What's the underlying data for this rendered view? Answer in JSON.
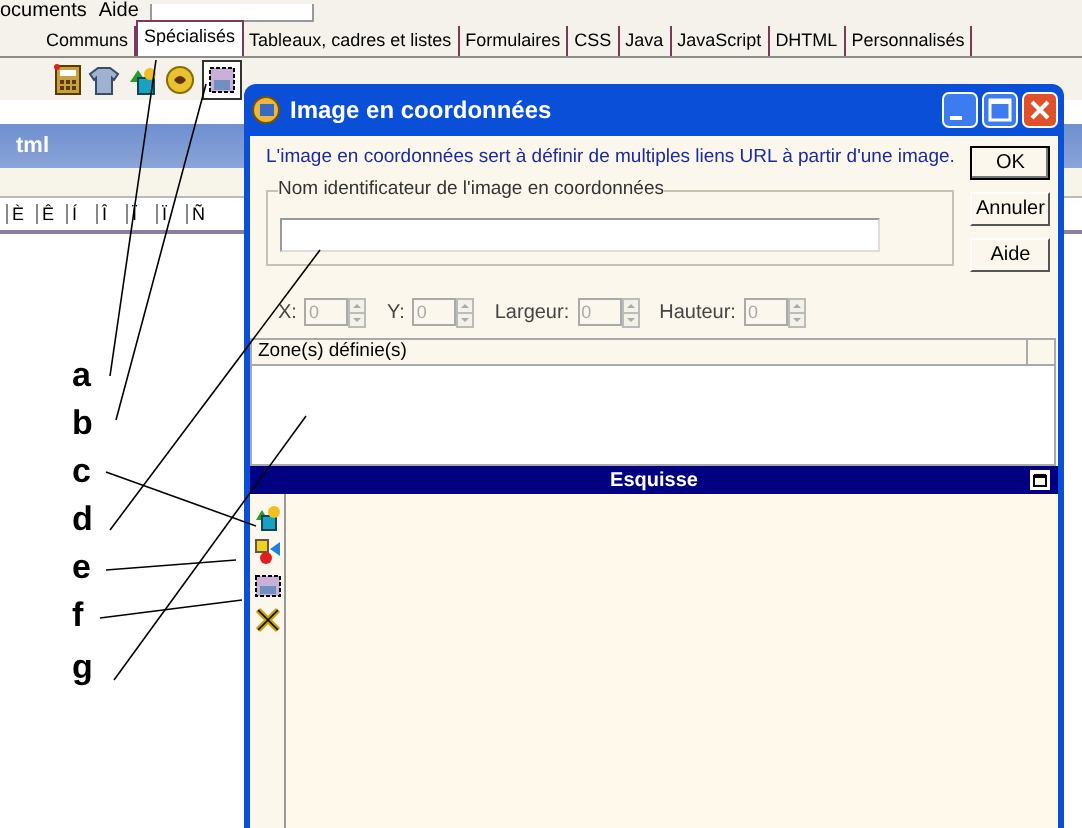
{
  "app_toolbar": {
    "menu_items": [
      "ocuments",
      "Aide"
    ]
  },
  "palette_tabs": [
    {
      "label": "Communs",
      "selected": false
    },
    {
      "label": "Spécialisés",
      "selected": true
    },
    {
      "label": "Tableaux, cadres et listes",
      "selected": false
    },
    {
      "label": "Formulaires",
      "selected": false
    },
    {
      "label": "CSS",
      "selected": false
    },
    {
      "label": "Java",
      "selected": false
    },
    {
      "label": "JavaScript",
      "selected": false
    },
    {
      "label": "DHTML",
      "selected": false
    },
    {
      "label": "Personnalisés",
      "selected": false
    }
  ],
  "editor": {
    "title": "tml",
    "characters": [
      "È",
      "Ê",
      "Í",
      "Î",
      "Ï",
      "Ï",
      "Ñ"
    ]
  },
  "dialog": {
    "title": "Image en coordonnées",
    "description": "L'image en coordonnées sert à définir de multiples liens URL à partir d'une image.",
    "name_group": {
      "label": "Nom identificateur de l'image en coordonnées"
    },
    "buttons": [
      "OK",
      "Annuler",
      "Aide"
    ],
    "coordinates": [
      {
        "label": "X:",
        "value": "0",
        "disabled": true
      },
      {
        "label": "Y:",
        "value": "0",
        "disabled": true
      },
      {
        "label": "Largeur:",
        "value": "0",
        "disabled": true
      },
      {
        "label": "Hauteur:",
        "value": "0",
        "disabled": true
      }
    ],
    "zones_list": {
      "header": "Zone(s) définie(s)"
    },
    "sketch_panel": {
      "title": "Esquisse"
    }
  },
  "callouts": [
    "a",
    "b",
    "c",
    "d",
    "e",
    "f",
    "g"
  ]
}
